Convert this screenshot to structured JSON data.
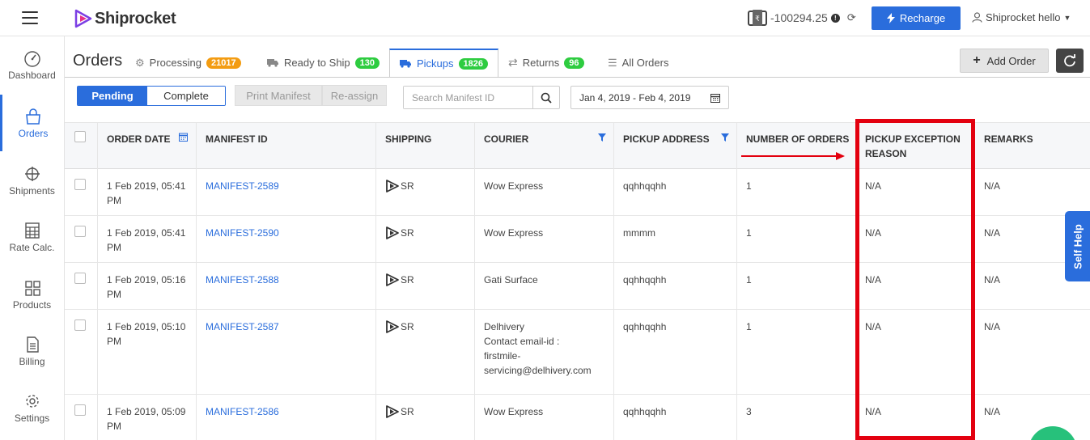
{
  "topbar": {
    "logo_text": "Shiprocket",
    "wallet_amount": "-100294.25",
    "recharge_label": "Recharge",
    "user_name": "Shiprocket hello"
  },
  "sidebar": {
    "items": [
      {
        "label": "Dashboard",
        "icon": "gauge-icon",
        "active": false
      },
      {
        "label": "Orders",
        "icon": "bag-icon",
        "active": true
      },
      {
        "label": "Shipments",
        "icon": "crosshair-icon",
        "active": false
      },
      {
        "label": "Rate Calc.",
        "icon": "calculator-icon",
        "active": false
      },
      {
        "label": "Products",
        "icon": "grid-icon",
        "active": false
      },
      {
        "label": "Billing",
        "icon": "document-icon",
        "active": false
      },
      {
        "label": "Settings",
        "icon": "gear-icon",
        "active": false
      }
    ]
  },
  "page": {
    "title": "Orders",
    "tabs": [
      {
        "label": "Processing",
        "count": "21017",
        "badge_color": "#f39c12",
        "icon": "gears-icon"
      },
      {
        "label": "Ready to Ship",
        "count": "130",
        "badge_color": "#2ecc40",
        "icon": "truck-icon"
      },
      {
        "label": "Pickups",
        "count": "1826",
        "badge_color": "#2ecc40",
        "icon": "truck-icon",
        "active": true
      },
      {
        "label": "Returns",
        "count": "96",
        "badge_color": "#2ecc40",
        "icon": "exchange-icon"
      },
      {
        "label": "All Orders",
        "icon": "list-icon"
      }
    ],
    "add_order_label": "Add Order"
  },
  "toolbar": {
    "pending_label": "Pending",
    "complete_label": "Complete",
    "print_manifest_label": "Print Manifest",
    "reassign_label": "Re-assign",
    "search_placeholder": "Search Manifest ID",
    "date_range": "Jan 4, 2019 - Feb 4, 2019"
  },
  "table": {
    "columns": [
      "ORDER DATE",
      "MANIFEST ID",
      "SHIPPING",
      "COURIER",
      "PICKUP ADDRESS",
      "NUMBER OF ORDERS",
      "PICKUP EXCEPTION REASON",
      "REMARKS"
    ],
    "rows": [
      {
        "date": "1 Feb 2019, 05:41 PM",
        "manifest": "MANIFEST-2589",
        "shipping": "SR",
        "courier": "Wow Express",
        "address": "qqhhqqhh",
        "orders": "1",
        "exception": "N/A",
        "remarks": "N/A"
      },
      {
        "date": "1 Feb 2019, 05:41 PM",
        "manifest": "MANIFEST-2590",
        "shipping": "SR",
        "courier": "Wow Express",
        "address": "mmmm",
        "orders": "1",
        "exception": "N/A",
        "remarks": "N/A"
      },
      {
        "date": "1 Feb 2019, 05:16 PM",
        "manifest": "MANIFEST-2588",
        "shipping": "SR",
        "courier": "Gati Surface",
        "address": "qqhhqqhh",
        "orders": "1",
        "exception": "N/A",
        "remarks": "N/A"
      },
      {
        "date": "1 Feb 2019, 05:10 PM",
        "manifest": "MANIFEST-2587",
        "shipping": "SR",
        "courier": "Delhivery\nContact email-id :\nfirstmile-\nservicing@delhivery.com",
        "address": "qqhhqqhh",
        "orders": "1",
        "exception": "N/A",
        "remarks": "N/A"
      },
      {
        "date": "1 Feb 2019, 05:09 PM",
        "manifest": "MANIFEST-2586",
        "shipping": "SR",
        "courier": "Wow Express",
        "address": "qqhhqqhh",
        "orders": "3",
        "exception": "N/A",
        "remarks": "N/A"
      }
    ]
  },
  "self_help_label": "Self Help",
  "colors": {
    "accent": "#2a6ddc",
    "highlight": "#e3000f"
  }
}
